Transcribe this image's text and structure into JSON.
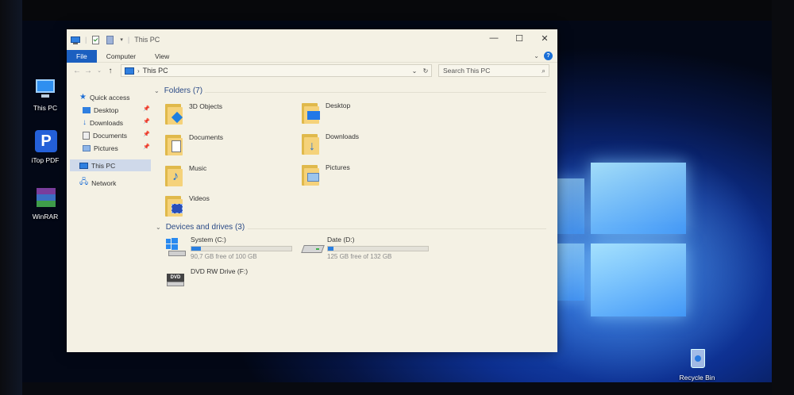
{
  "window": {
    "title": "This PC",
    "caption": {
      "minimize": "—",
      "maximize": "☐",
      "close": "✕"
    }
  },
  "ribbon": {
    "tabs": [
      "File",
      "Computer",
      "View"
    ],
    "help": "?"
  },
  "address": {
    "path": "This PC",
    "search_placeholder": "Search This PC"
  },
  "nav": {
    "quick_access": "Quick access",
    "quick_items": [
      {
        "label": "Desktop",
        "icon": "desktop-folder-icon"
      },
      {
        "label": "Downloads",
        "icon": "downloads-folder-icon"
      },
      {
        "label": "Documents",
        "icon": "documents-folder-icon"
      },
      {
        "label": "Pictures",
        "icon": "pictures-folder-icon"
      }
    ],
    "this_pc": "This PC",
    "network": "Network"
  },
  "folders": {
    "header": "Folders (7)",
    "items": [
      {
        "label": "3D Objects"
      },
      {
        "label": "Desktop"
      },
      {
        "label": "Documents"
      },
      {
        "label": "Downloads"
      },
      {
        "label": "Music"
      },
      {
        "label": "Pictures"
      },
      {
        "label": "Videos"
      }
    ]
  },
  "drives": {
    "header": "Devices and drives (3)",
    "items": [
      {
        "label": "System (C:)",
        "free": "90,7 GB free of 100 GB",
        "used_fraction": 0.093
      },
      {
        "label": "Date (D:)",
        "free": "125 GB free of 132 GB",
        "used_fraction": 0.053
      },
      {
        "label": "DVD RW Drive (F:)"
      }
    ]
  },
  "desktop_icons": [
    {
      "label": "This PC"
    },
    {
      "label": "iTop PDF"
    },
    {
      "label": "WinRAR"
    },
    {
      "label": "Recycle Bin"
    }
  ],
  "colors": {
    "accent": "#1b5fc0",
    "folder": "#f5d27a",
    "drive_fill": "#2a7fe0"
  }
}
